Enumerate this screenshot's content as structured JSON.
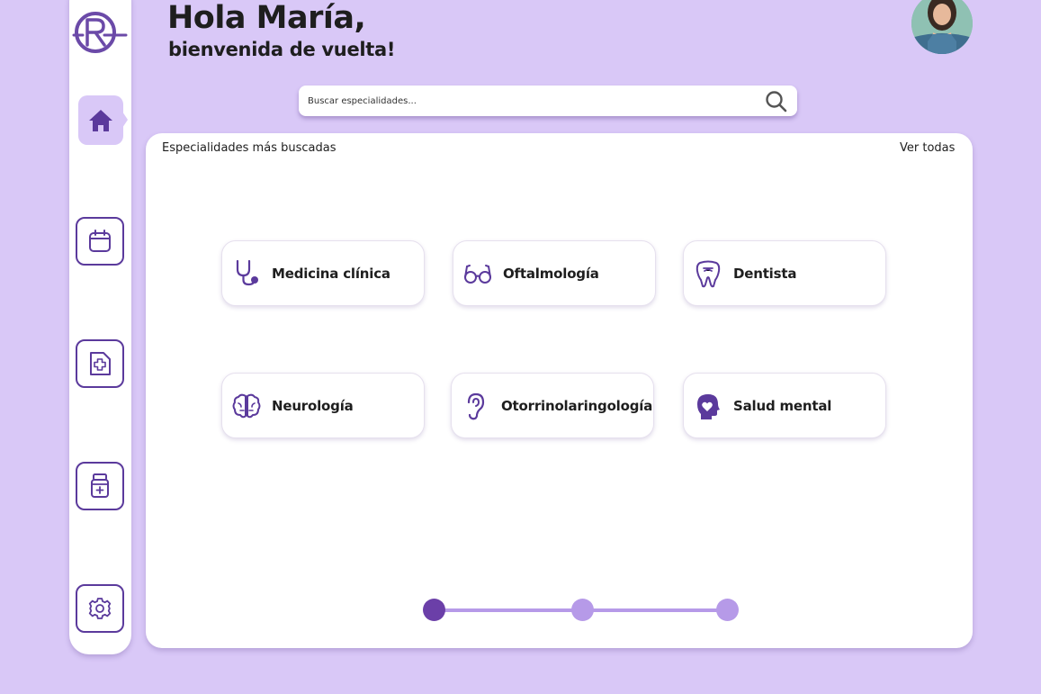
{
  "header": {
    "title": "Hola María,",
    "subtitle": "bienvenida de vuelta!"
  },
  "search": {
    "placeholder": "Buscar especialidades..."
  },
  "section": {
    "title": "Especialidades más buscadas",
    "see_all": "Ver todas"
  },
  "specialties": [
    {
      "label": "Medicina clínica",
      "icon": "stethoscope-icon"
    },
    {
      "label": "Oftalmología",
      "icon": "glasses-icon"
    },
    {
      "label": "Dentista",
      "icon": "tooth-icon"
    },
    {
      "label": "Neurología",
      "icon": "brain-icon"
    },
    {
      "label": "Otorrinolaringología",
      "icon": "ear-icon"
    },
    {
      "label": "Salud mental",
      "icon": "head-heart-icon"
    }
  ],
  "sidebar": {
    "items": [
      {
        "name": "home",
        "icon": "home-icon",
        "active": true
      },
      {
        "name": "appointments",
        "icon": "calendar-icon"
      },
      {
        "name": "medical-records",
        "icon": "medical-file-icon"
      },
      {
        "name": "medications",
        "icon": "medicine-bottle-icon"
      },
      {
        "name": "settings",
        "icon": "gear-icon"
      }
    ]
  },
  "pager": {
    "pages": 3,
    "active": 1
  },
  "colors": {
    "background": "#d9c8f7",
    "accent": "#5b3a9c",
    "accent_light": "#b69ae8",
    "active_dot": "#6b3fa8"
  }
}
